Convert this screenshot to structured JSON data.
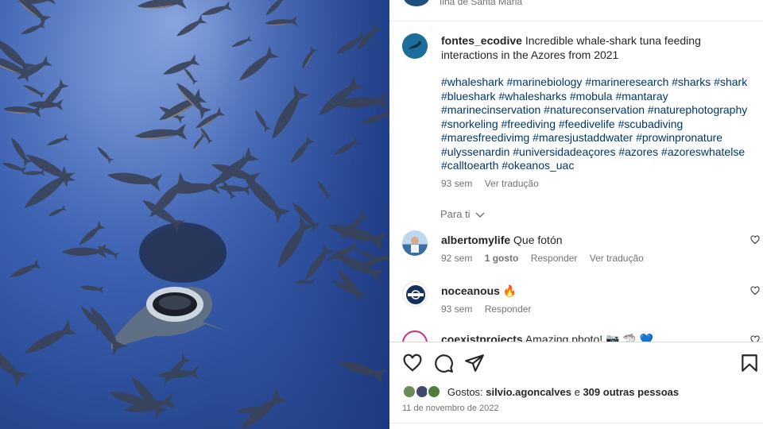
{
  "post": {
    "location": "Ilha de Santa Maria",
    "author": "fontes_ecodive",
    "caption": "Incredible whale-shark tuna feeding interactions in the Azores from 2021",
    "hashtags": "#whaleshark #marinebiology #marineresearch #sharks #shark #blueshark #whalesharks #mobula #mantaray #marinecinservation #natureconservation #naturephotography #snorkeling #freediving #feedivelife #scubadiving #maresfreedivimg #maresjustaddwater #prowinpronature #ulyssenardin #universidadeaçores #azores #azoreswhatelse #calltoearth #okeanos_uac",
    "caption_time": "93 sem",
    "see_translation": "Ver tradução",
    "for_you": "Para ti",
    "likes_label": "Gostos:",
    "likes_user": "silvio.agoncalves",
    "likes_and": "e",
    "likes_others": "309 outras pessoas",
    "date": "11 de novembro de 2022"
  },
  "comments": [
    {
      "user": "albertomylife",
      "text": "Que fotón",
      "time": "92 sem",
      "likes": "1 gosto",
      "reply": "Responder",
      "translate": "Ver tradução"
    },
    {
      "user": "noceanous",
      "text": "🔥",
      "time": "93 sem",
      "reply": "Responder"
    },
    {
      "user": "coexistprojects",
      "text": "Amazing photo! 📷 🦈 💙"
    }
  ],
  "icons": [
    "heart-icon",
    "comment-icon",
    "share-icon",
    "bookmark-icon"
  ],
  "colors": {
    "link": "#00376b",
    "muted": "#737373",
    "ocean": "#2b4d98"
  }
}
